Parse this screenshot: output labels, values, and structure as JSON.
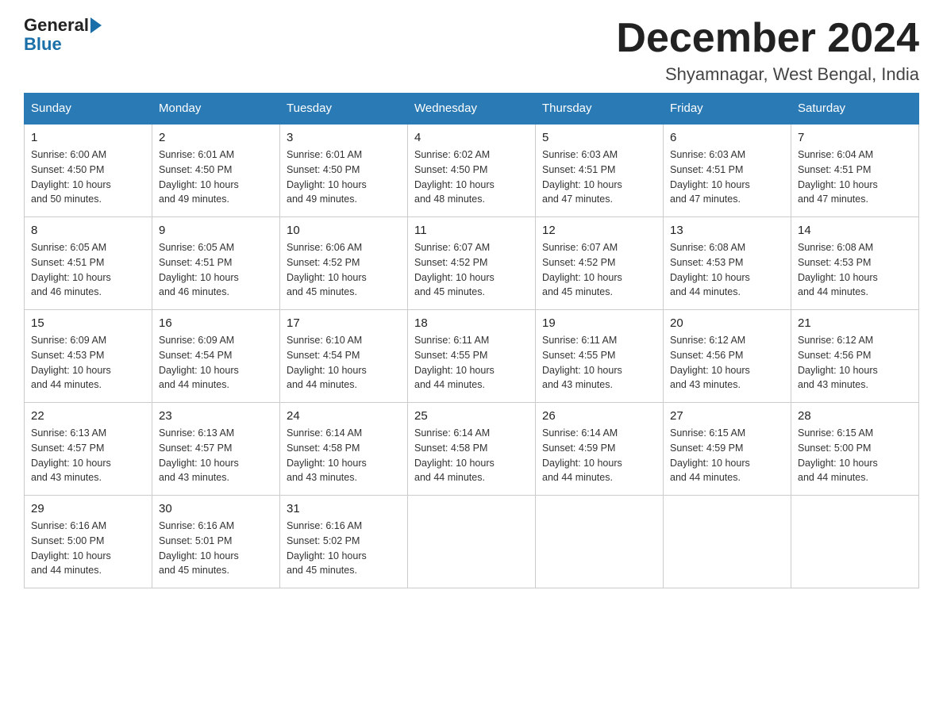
{
  "logo": {
    "text_general": "General",
    "text_blue": "Blue"
  },
  "title": {
    "month": "December 2024",
    "location": "Shyamnagar, West Bengal, India"
  },
  "days_of_week": [
    "Sunday",
    "Monday",
    "Tuesday",
    "Wednesday",
    "Thursday",
    "Friday",
    "Saturday"
  ],
  "weeks": [
    [
      {
        "day": "1",
        "sunrise": "6:00 AM",
        "sunset": "4:50 PM",
        "daylight": "10 hours and 50 minutes."
      },
      {
        "day": "2",
        "sunrise": "6:01 AM",
        "sunset": "4:50 PM",
        "daylight": "10 hours and 49 minutes."
      },
      {
        "day": "3",
        "sunrise": "6:01 AM",
        "sunset": "4:50 PM",
        "daylight": "10 hours and 49 minutes."
      },
      {
        "day": "4",
        "sunrise": "6:02 AM",
        "sunset": "4:50 PM",
        "daylight": "10 hours and 48 minutes."
      },
      {
        "day": "5",
        "sunrise": "6:03 AM",
        "sunset": "4:51 PM",
        "daylight": "10 hours and 47 minutes."
      },
      {
        "day": "6",
        "sunrise": "6:03 AM",
        "sunset": "4:51 PM",
        "daylight": "10 hours and 47 minutes."
      },
      {
        "day": "7",
        "sunrise": "6:04 AM",
        "sunset": "4:51 PM",
        "daylight": "10 hours and 47 minutes."
      }
    ],
    [
      {
        "day": "8",
        "sunrise": "6:05 AM",
        "sunset": "4:51 PM",
        "daylight": "10 hours and 46 minutes."
      },
      {
        "day": "9",
        "sunrise": "6:05 AM",
        "sunset": "4:51 PM",
        "daylight": "10 hours and 46 minutes."
      },
      {
        "day": "10",
        "sunrise": "6:06 AM",
        "sunset": "4:52 PM",
        "daylight": "10 hours and 45 minutes."
      },
      {
        "day": "11",
        "sunrise": "6:07 AM",
        "sunset": "4:52 PM",
        "daylight": "10 hours and 45 minutes."
      },
      {
        "day": "12",
        "sunrise": "6:07 AM",
        "sunset": "4:52 PM",
        "daylight": "10 hours and 45 minutes."
      },
      {
        "day": "13",
        "sunrise": "6:08 AM",
        "sunset": "4:53 PM",
        "daylight": "10 hours and 44 minutes."
      },
      {
        "day": "14",
        "sunrise": "6:08 AM",
        "sunset": "4:53 PM",
        "daylight": "10 hours and 44 minutes."
      }
    ],
    [
      {
        "day": "15",
        "sunrise": "6:09 AM",
        "sunset": "4:53 PM",
        "daylight": "10 hours and 44 minutes."
      },
      {
        "day": "16",
        "sunrise": "6:09 AM",
        "sunset": "4:54 PM",
        "daylight": "10 hours and 44 minutes."
      },
      {
        "day": "17",
        "sunrise": "6:10 AM",
        "sunset": "4:54 PM",
        "daylight": "10 hours and 44 minutes."
      },
      {
        "day": "18",
        "sunrise": "6:11 AM",
        "sunset": "4:55 PM",
        "daylight": "10 hours and 44 minutes."
      },
      {
        "day": "19",
        "sunrise": "6:11 AM",
        "sunset": "4:55 PM",
        "daylight": "10 hours and 43 minutes."
      },
      {
        "day": "20",
        "sunrise": "6:12 AM",
        "sunset": "4:56 PM",
        "daylight": "10 hours and 43 minutes."
      },
      {
        "day": "21",
        "sunrise": "6:12 AM",
        "sunset": "4:56 PM",
        "daylight": "10 hours and 43 minutes."
      }
    ],
    [
      {
        "day": "22",
        "sunrise": "6:13 AM",
        "sunset": "4:57 PM",
        "daylight": "10 hours and 43 minutes."
      },
      {
        "day": "23",
        "sunrise": "6:13 AM",
        "sunset": "4:57 PM",
        "daylight": "10 hours and 43 minutes."
      },
      {
        "day": "24",
        "sunrise": "6:14 AM",
        "sunset": "4:58 PM",
        "daylight": "10 hours and 43 minutes."
      },
      {
        "day": "25",
        "sunrise": "6:14 AM",
        "sunset": "4:58 PM",
        "daylight": "10 hours and 44 minutes."
      },
      {
        "day": "26",
        "sunrise": "6:14 AM",
        "sunset": "4:59 PM",
        "daylight": "10 hours and 44 minutes."
      },
      {
        "day": "27",
        "sunrise": "6:15 AM",
        "sunset": "4:59 PM",
        "daylight": "10 hours and 44 minutes."
      },
      {
        "day": "28",
        "sunrise": "6:15 AM",
        "sunset": "5:00 PM",
        "daylight": "10 hours and 44 minutes."
      }
    ],
    [
      {
        "day": "29",
        "sunrise": "6:16 AM",
        "sunset": "5:00 PM",
        "daylight": "10 hours and 44 minutes."
      },
      {
        "day": "30",
        "sunrise": "6:16 AM",
        "sunset": "5:01 PM",
        "daylight": "10 hours and 45 minutes."
      },
      {
        "day": "31",
        "sunrise": "6:16 AM",
        "sunset": "5:02 PM",
        "daylight": "10 hours and 45 minutes."
      },
      null,
      null,
      null,
      null
    ]
  ],
  "labels": {
    "sunrise": "Sunrise:",
    "sunset": "Sunset:",
    "daylight": "Daylight:"
  }
}
